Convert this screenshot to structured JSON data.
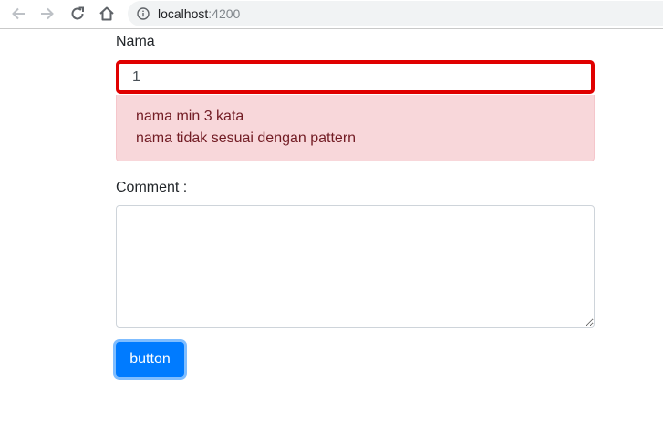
{
  "browser": {
    "url_host": "localhost",
    "url_port": ":4200"
  },
  "form": {
    "nama_label": "Nama",
    "nama_value": "1",
    "errors": [
      "nama min 3 kata",
      "nama tidak sesuai dengan pattern"
    ],
    "comment_label": "Comment :",
    "comment_value": "",
    "button_label": "button"
  },
  "colors": {
    "input_error_border": "#e00000",
    "alert_background": "#f8d7da",
    "alert_text": "#721c24",
    "button_primary": "#007bff"
  }
}
